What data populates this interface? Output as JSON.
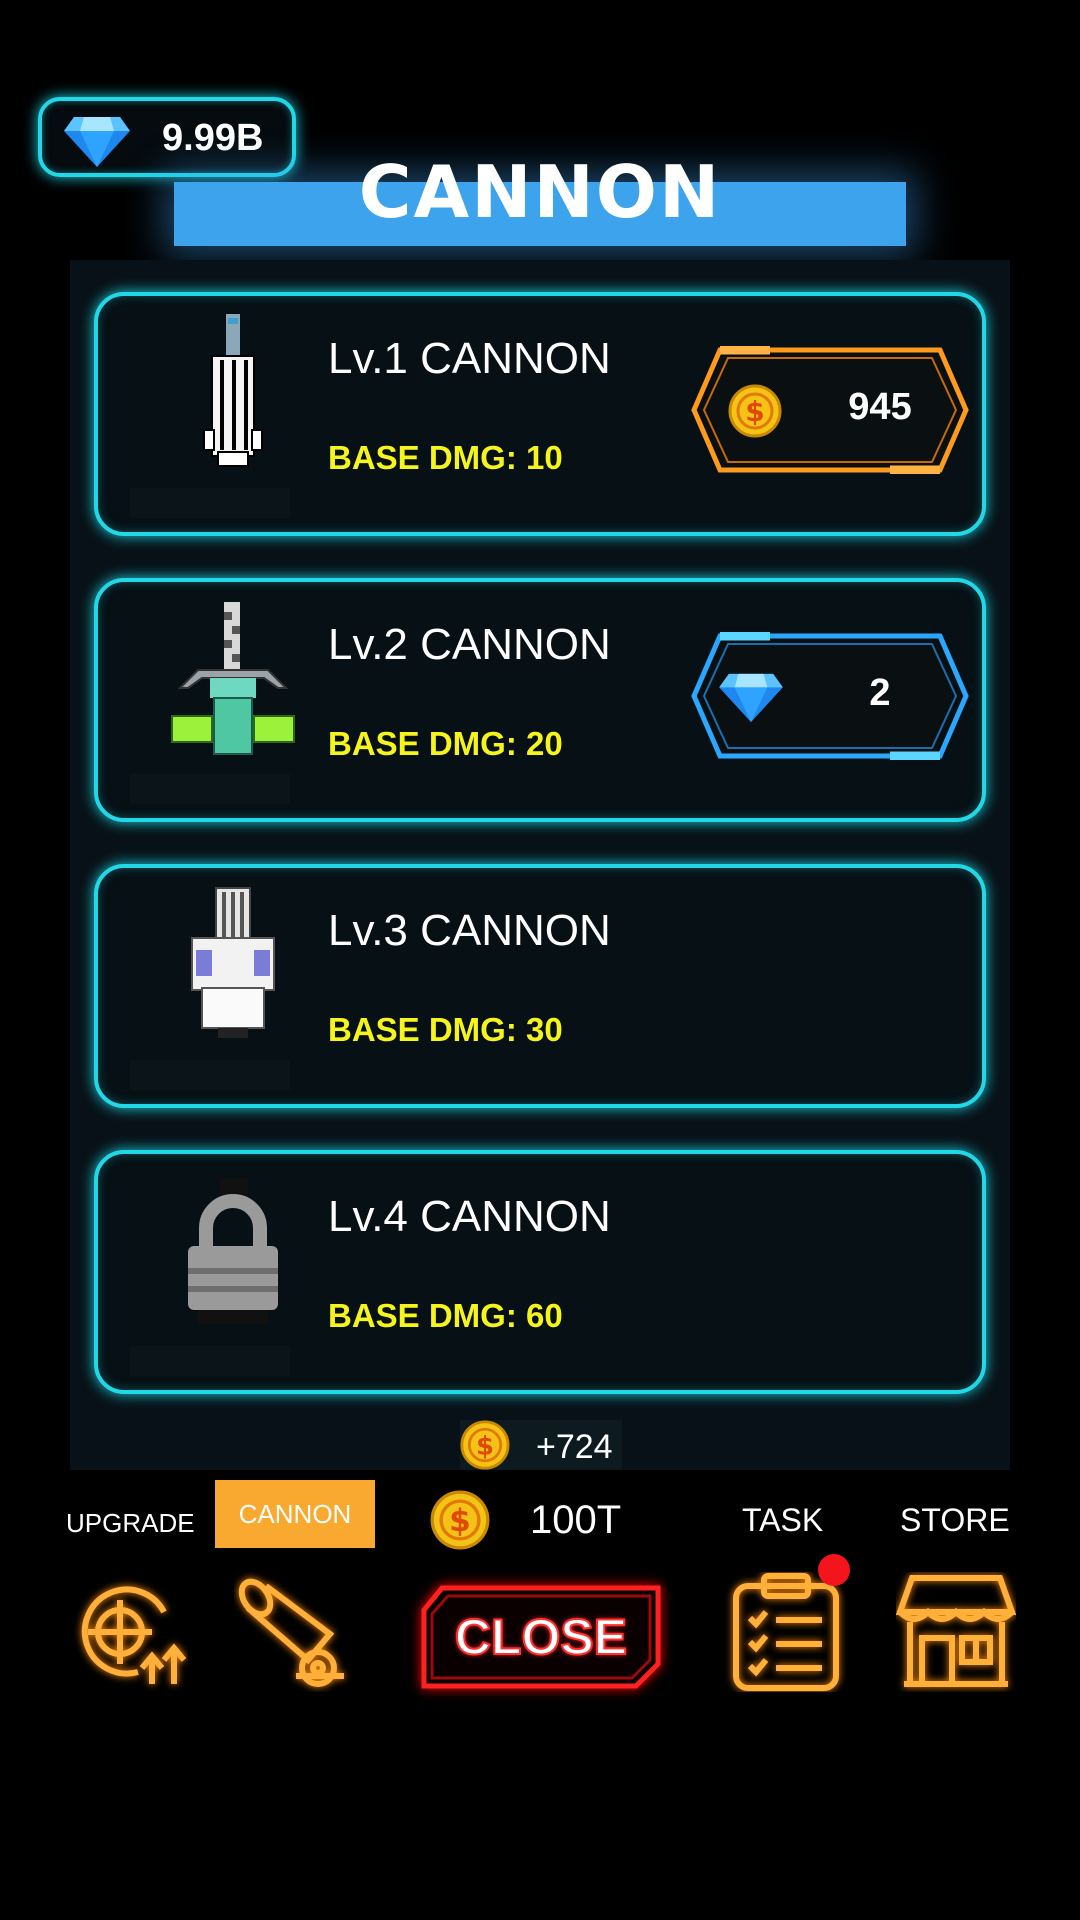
{
  "gems": {
    "value": "9.99B",
    "icon": "diamond-gem-icon"
  },
  "screen_title": "CANNON",
  "cannons": [
    {
      "name": "Lv.1 CANNON",
      "base_dmg": "BASE DMG: 10",
      "price": "945",
      "currency": "coin",
      "locked": false
    },
    {
      "name": "Lv.2 CANNON",
      "base_dmg": "BASE DMG: 20",
      "price": "2",
      "currency": "gem",
      "locked": false
    },
    {
      "name": "Lv.3 CANNON",
      "base_dmg": "BASE DMG: 30",
      "price": "",
      "currency": "",
      "locked": false
    },
    {
      "name": "Lv.4 CANNON",
      "base_dmg": "BASE DMG: 60",
      "price": "",
      "currency": "",
      "locked": true
    }
  ],
  "earning": "+724",
  "bottom_bar": {
    "upgrade_label": "UPGRADE",
    "cannon_label": "CANNON",
    "coins_total": "100T",
    "task_label": "TASK",
    "store_label": "STORE",
    "close_label": "CLOSE",
    "task_badge": true
  },
  "colors": {
    "neon_cyan": "#22d8e6",
    "neon_orange": "#ff9a1a",
    "title_blue": "#3da3ec",
    "dmg_yellow": "#f5f51c",
    "tab_active": "#f9a92f",
    "close_red": "#ff2020",
    "badge_red": "#f3141c"
  }
}
